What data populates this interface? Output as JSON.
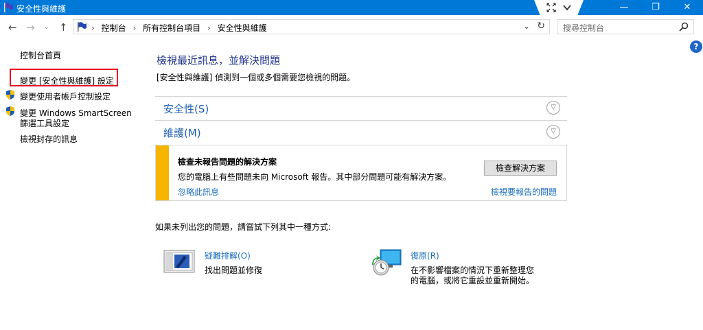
{
  "window": {
    "title": "安全性與維護",
    "minimize": "—",
    "maximize": "❐",
    "close": "✕"
  },
  "address": {
    "crumbs": [
      "控制台",
      "所有控制台項目",
      "安全性與維護"
    ],
    "separator": "›",
    "search_placeholder": "搜尋控制台"
  },
  "sidebar": {
    "home": "控制台首頁",
    "items": [
      {
        "label": "變更 [安全性與維護] 設定"
      },
      {
        "label": "變更使用者帳戶控制設定"
      },
      {
        "label_line1": "變更 Windows SmartScreen",
        "label_line2": "篩選工具設定"
      },
      {
        "label": "檢視封存的訊息"
      }
    ]
  },
  "main": {
    "title": "檢視最近訊息，並解決問題",
    "description": "[安全性與維護] 偵測到一個或多個需要您檢視的問題。",
    "sections": [
      {
        "label": "安全性(S)"
      },
      {
        "label": "維護(M)"
      }
    ],
    "message": {
      "title": "檢查未報告問題的解決方案",
      "text": "您的電腦上有些問題未向 Microsoft 報告。其中部分問題可能有解決方案。",
      "ignore": "忽略此訊息",
      "button": "檢查解決方案",
      "view_link": "檢視要報告的問題"
    },
    "tip": "如果未列出您的問題，請嘗試下列其中一種方式:",
    "tools": [
      {
        "name": "疑難排解(O)",
        "desc": "找出問題並修復"
      },
      {
        "name": "復原(R)",
        "desc_line1": "在不影響檔案的情況下重新整理您",
        "desc_line2": "的電腦，或將它重設並重新開始。"
      }
    ]
  },
  "colors": {
    "titlebar": "#0078d7",
    "link": "#1e6fbf",
    "heading": "#1e3287",
    "warning": "#f7b500",
    "highlight": "#e81123"
  }
}
